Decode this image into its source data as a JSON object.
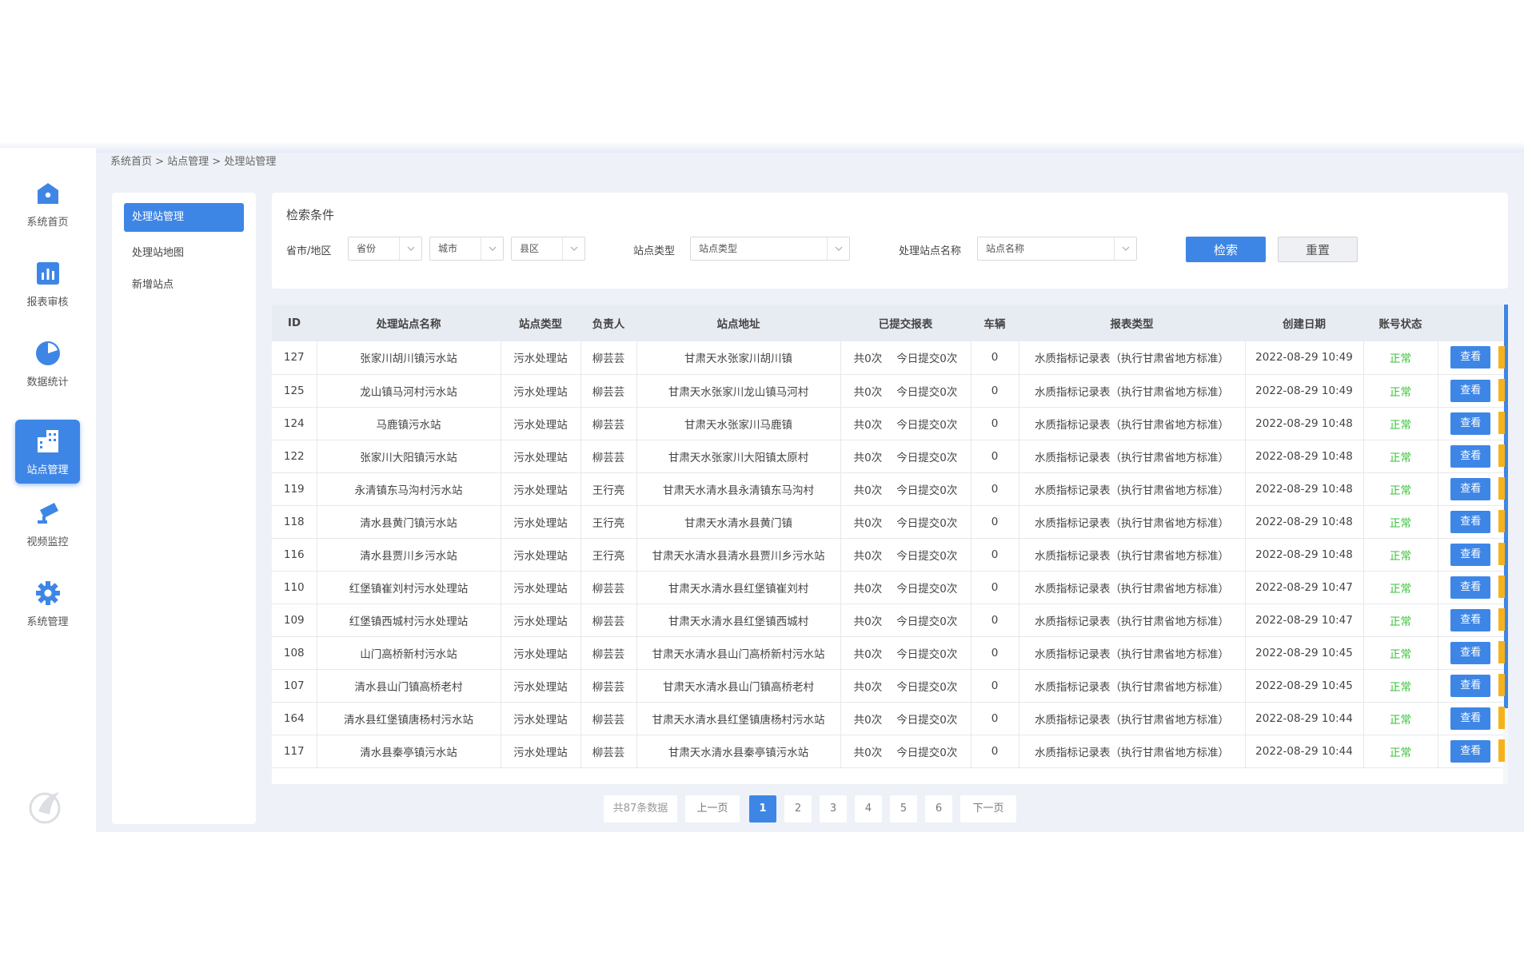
{
  "breadcrumb": "系统首页 > 站点管理 > 处理站管理",
  "nav": [
    {
      "label": "系统首页",
      "icon": "home-icon"
    },
    {
      "label": "报表审核",
      "icon": "bar-chart-icon"
    },
    {
      "label": "数据统计",
      "icon": "pie-chart-icon"
    },
    {
      "label": "站点管理",
      "icon": "building-icon"
    },
    {
      "label": "视频监控",
      "icon": "camera-icon"
    },
    {
      "label": "系统管理",
      "icon": "gear-icon"
    }
  ],
  "submenu": [
    "处理站管理",
    "处理站地图",
    "新增站点"
  ],
  "search": {
    "title": "检索条件",
    "region_label": "省市/地区",
    "province": "省份",
    "city": "城市",
    "county": "县区",
    "type_label": "站点类型",
    "type_value": "站点类型",
    "name_label": "处理站点名称",
    "name_value": "站点名称",
    "search_btn": "检索",
    "reset_btn": "重置"
  },
  "table": {
    "headers": [
      "ID",
      "处理站点名称",
      "站点类型",
      "负责人",
      "站点地址",
      "已提交报表",
      "车辆",
      "报表类型",
      "创建日期",
      "账号状态",
      ""
    ],
    "rows": [
      [
        "127",
        "张家川胡川镇污水站",
        "污水处理站",
        "柳芸芸",
        "甘肃天水张家川胡川镇",
        "共0次",
        "今日提交0次",
        "0",
        "水质指标记录表（执行甘肃省地方标准）",
        "2022-08-29 10:49",
        "正常",
        "查看"
      ],
      [
        "125",
        "龙山镇马河村污水站",
        "污水处理站",
        "柳芸芸",
        "甘肃天水张家川龙山镇马河村",
        "共0次",
        "今日提交0次",
        "0",
        "水质指标记录表（执行甘肃省地方标准）",
        "2022-08-29 10:49",
        "正常",
        "查看"
      ],
      [
        "124",
        "马鹿镇污水站",
        "污水处理站",
        "柳芸芸",
        "甘肃天水张家川马鹿镇",
        "共0次",
        "今日提交0次",
        "0",
        "水质指标记录表（执行甘肃省地方标准）",
        "2022-08-29 10:48",
        "正常",
        "查看"
      ],
      [
        "122",
        "张家川大阳镇污水站",
        "污水处理站",
        "柳芸芸",
        "甘肃天水张家川大阳镇太原村",
        "共0次",
        "今日提交0次",
        "0",
        "水质指标记录表（执行甘肃省地方标准）",
        "2022-08-29 10:48",
        "正常",
        "查看"
      ],
      [
        "119",
        "永清镇东马沟村污水站",
        "污水处理站",
        "王行亮",
        "甘肃天水清水县永清镇东马沟村",
        "共0次",
        "今日提交0次",
        "0",
        "水质指标记录表（执行甘肃省地方标准）",
        "2022-08-29 10:48",
        "正常",
        "查看"
      ],
      [
        "118",
        "清水县黄门镇污水站",
        "污水处理站",
        "王行亮",
        "甘肃天水清水县黄门镇",
        "共0次",
        "今日提交0次",
        "0",
        "水质指标记录表（执行甘肃省地方标准）",
        "2022-08-29 10:48",
        "正常",
        "查看"
      ],
      [
        "116",
        "清水县贾川乡污水站",
        "污水处理站",
        "王行亮",
        "甘肃天水清水县清水县贾川乡污水站",
        "共0次",
        "今日提交0次",
        "0",
        "水质指标记录表（执行甘肃省地方标准）",
        "2022-08-29 10:48",
        "正常",
        "查看"
      ],
      [
        "110",
        "红堡镇崔刘村污水处理站",
        "污水处理站",
        "柳芸芸",
        "甘肃天水清水县红堡镇崔刘村",
        "共0次",
        "今日提交0次",
        "0",
        "水质指标记录表（执行甘肃省地方标准）",
        "2022-08-29 10:47",
        "正常",
        "查看"
      ],
      [
        "109",
        "红堡镇西城村污水处理站",
        "污水处理站",
        "柳芸芸",
        "甘肃天水清水县红堡镇西城村",
        "共0次",
        "今日提交0次",
        "0",
        "水质指标记录表（执行甘肃省地方标准）",
        "2022-08-29 10:47",
        "正常",
        "查看"
      ],
      [
        "108",
        "山门高桥新村污水站",
        "污水处理站",
        "柳芸芸",
        "甘肃天水清水县山门高桥新村污水站",
        "共0次",
        "今日提交0次",
        "0",
        "水质指标记录表（执行甘肃省地方标准）",
        "2022-08-29 10:45",
        "正常",
        "查看"
      ],
      [
        "107",
        "清水县山门镇高桥老村",
        "污水处理站",
        "柳芸芸",
        "甘肃天水清水县山门镇高桥老村",
        "共0次",
        "今日提交0次",
        "0",
        "水质指标记录表（执行甘肃省地方标准）",
        "2022-08-29 10:45",
        "正常",
        "查看"
      ],
      [
        "164",
        "清水县红堡镇唐杨村污水站",
        "污水处理站",
        "柳芸芸",
        "甘肃天水清水县红堡镇唐杨村污水站",
        "共0次",
        "今日提交0次",
        "0",
        "水质指标记录表（执行甘肃省地方标准）",
        "2022-08-29 10:44",
        "正常",
        "查看"
      ],
      [
        "117",
        "清水县秦亭镇污水站",
        "污水处理站",
        "柳芸芸",
        "甘肃天水清水县秦亭镇污水站",
        "共0次",
        "今日提交0次",
        "0",
        "水质指标记录表（执行甘肃省地方标准）",
        "2022-08-29 10:44",
        "正常",
        "查看"
      ]
    ]
  },
  "pagination": {
    "total": "共87条数据",
    "prev": "上一页",
    "pages": [
      "1",
      "2",
      "3",
      "4",
      "5",
      "6"
    ],
    "current": "1",
    "next": "下一页"
  },
  "colors": {
    "accent": "#3e86e6",
    "ok": "#37c137",
    "warn": "#f6b21b"
  }
}
